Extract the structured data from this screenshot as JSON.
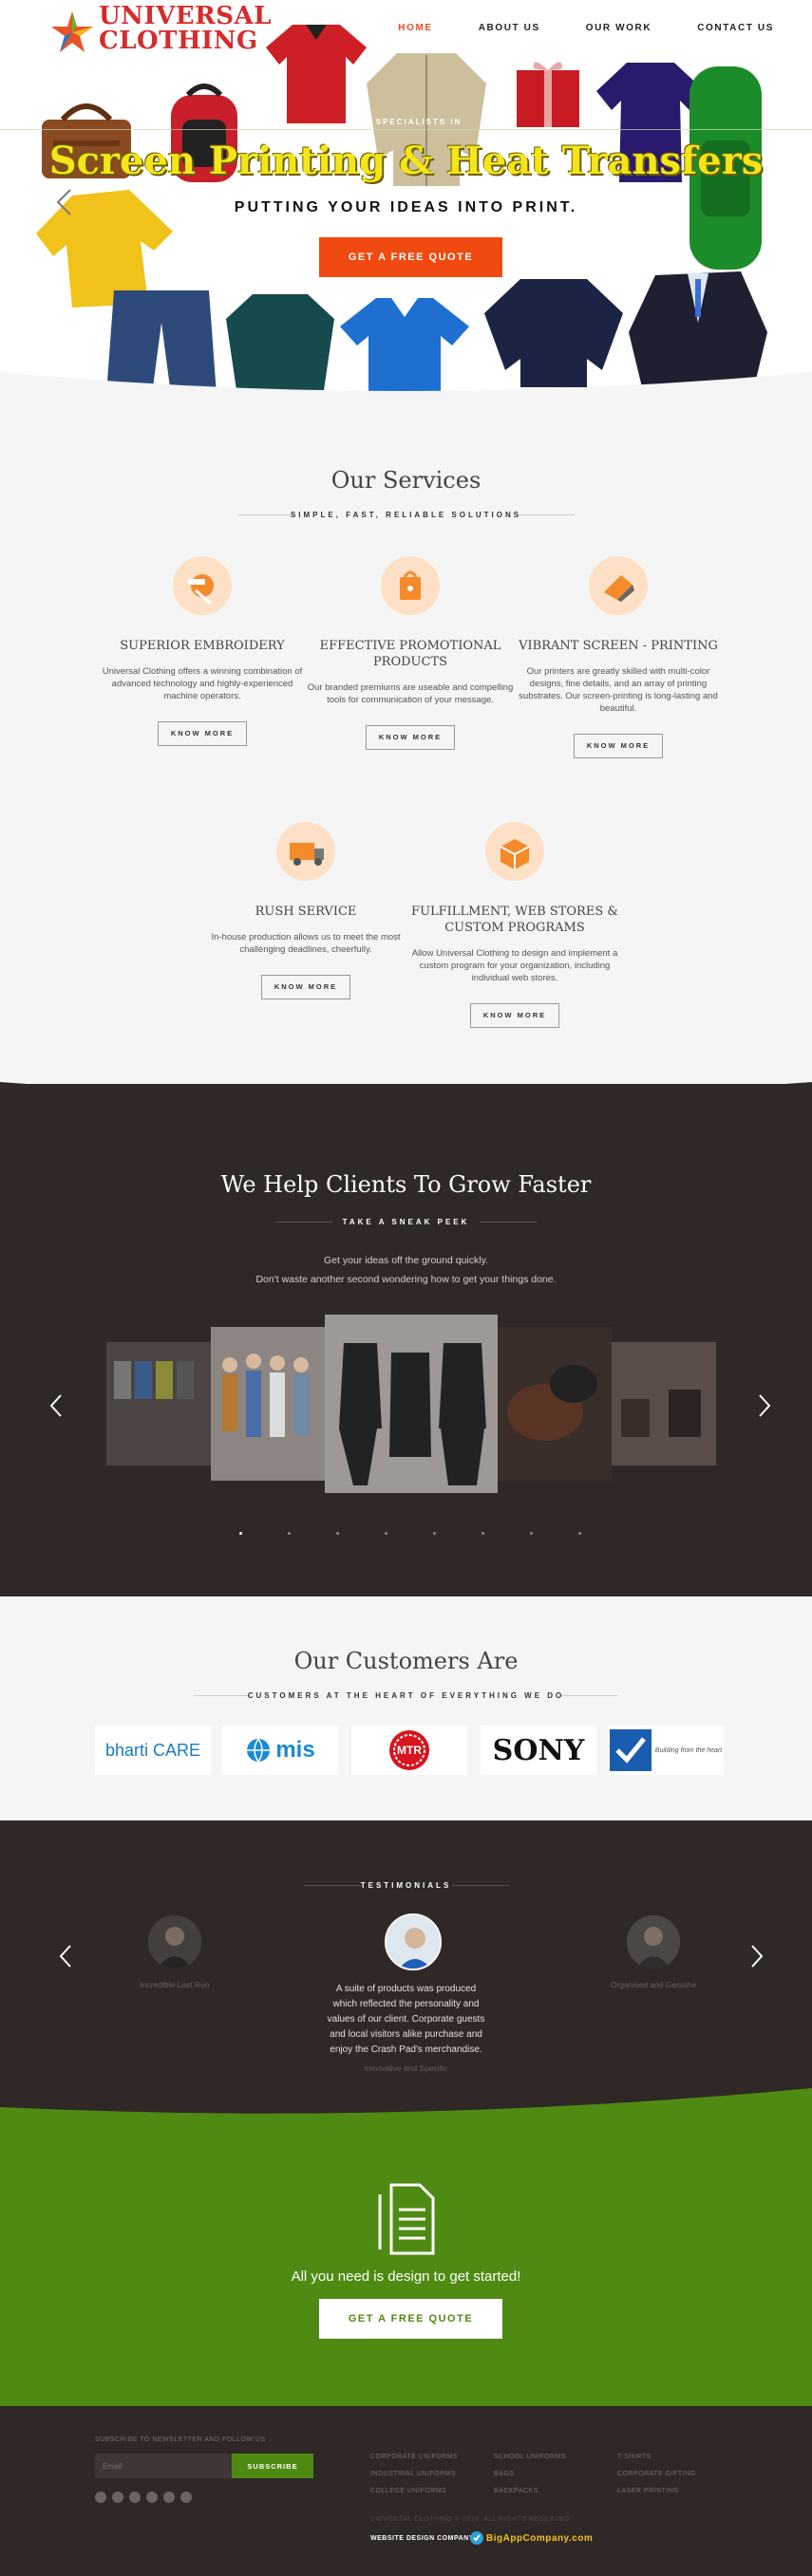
{
  "header": {
    "logo_line1": "UNIVERSAL",
    "logo_line2": "CLOTHING",
    "nav": [
      "HOME",
      "ABOUT US",
      "OUR WORK",
      "CONTACT US"
    ]
  },
  "hero": {
    "kicker": "ARE SPECIALISTS IN",
    "title": "Screen Printing & Heat Transfers",
    "subtitle": "PUTTING YOUR IDEAS INTO PRINT.",
    "cta": "GET A FREE QUOTE"
  },
  "services": {
    "title": "Our Services",
    "subtitle": "SIMPLE, FAST, RELIABLE SOLUTIONS",
    "items": [
      {
        "title": "SUPERIOR EMBROIDERY",
        "text": "Universal Clothing offers a winning combination of advanced technology and highly-experienced machine operators.",
        "button": "KNOW MORE",
        "icon": "embroidery-icon"
      },
      {
        "title": "EFFECTIVE PROMOTIONAL PRODUCTS",
        "text": "Our branded premiums are useable and compelling tools for communication of your message.",
        "button": "KNOW MORE",
        "icon": "shopping-bag-icon"
      },
      {
        "title": "VIBRANT SCREEN - PRINTING",
        "text": "Our printers are greatly skilled with multi-color designs, fine details, and an array of printing substrates. Our screen-printing is long-lasting and beautiful.",
        "button": "KNOW MORE",
        "icon": "eraser-icon"
      },
      {
        "title": "RUSH SERVICE",
        "text": "In-house production allows us to meet the most challenging deadlines, cheerfully.",
        "button": "KNOW MORE",
        "icon": "truck-icon"
      },
      {
        "title": "FULFILLMENT, WEB STORES & CUSTOM PROGRAMS",
        "text": "Allow Universal Clothing to design and implement a custom program for your organization, including individual web stores.",
        "button": "KNOW MORE",
        "icon": "box-icon"
      }
    ]
  },
  "clients": {
    "title": "We Help Clients To Grow Faster",
    "subtitle": "TAKE A SNEAK PEEK",
    "desc_line1": "Get your ideas off the ground quickly.",
    "desc_line2": "Don't waste another second wondering how to get your things done.",
    "slide_count": 8,
    "active_slide": 1
  },
  "customers": {
    "title": "Our Customers Are",
    "subtitle": "CUSTOMERS AT THE HEART OF EVERYTHING WE DO",
    "logos": [
      "bharti CARE",
      "mis",
      "MTR",
      "SONY",
      "Building from the heart"
    ]
  },
  "testimonials": {
    "heading": "TESTIMONIALS",
    "quote": "A suite of products was produced which reflected the personality and values of our client. Corporate guests and local visitors alike purchase and enjoy the Crash Pad's merchandise.",
    "author": "Innovative and Specific",
    "side_left": "Incredible Last Run",
    "side_right": "Organised and Genuine"
  },
  "cta": {
    "text": "All you need is design to get started!",
    "button": "GET A FREE QUOTE"
  },
  "footer": {
    "newsletter_label": "SUBSCRIBE TO NEWSLETTER AND FOLLOW US",
    "email_placeholder": "Email",
    "subscribe": "SUBSCRIBE",
    "links_col1": [
      "CORPORATE UNIFORMS",
      "INDUSTRIAL UNIFORMS",
      "COLLEGE UNIFORMS"
    ],
    "links_col2": [
      "SCHOOL UNIFORMS",
      "BAGS",
      "BACKPACKS"
    ],
    "links_col3": [
      "T-SHIRTS",
      "CORPORATE GIFTING",
      "LASER PRINTING"
    ],
    "copyright": "UNIVERSAL CLOTHING © 2016. ALL RIGHTS RESERVED",
    "credit_label": "WEBSITE DESIGN COMPANY",
    "credit_brand": "BigAppCompany.com"
  },
  "colors": {
    "accent": "#f04a10",
    "dark": "#2f2826",
    "green": "#4f8a12",
    "hero_title": "#f3e51a",
    "icon_bg": "#fde0c6"
  }
}
